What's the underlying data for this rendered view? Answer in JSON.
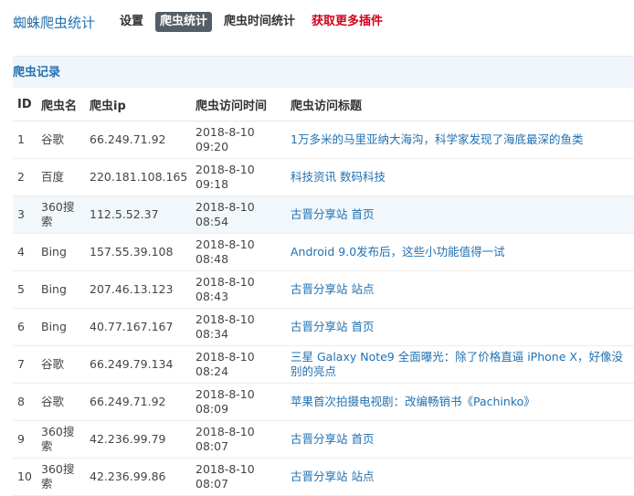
{
  "header": {
    "brand": "蜘蛛爬虫统计",
    "nav": [
      {
        "label": "设置"
      },
      {
        "label": "爬虫统计"
      },
      {
        "label": "爬虫时间统计"
      },
      {
        "label": "获取更多插件"
      }
    ]
  },
  "panel": {
    "title": "爬虫记录",
    "columns": [
      "ID",
      "爬虫名",
      "爬虫ip",
      "爬虫访问时间",
      "爬虫访问标题"
    ],
    "rows": [
      {
        "id": "1",
        "name": "谷歌",
        "ip": "66.249.71.92",
        "date": "2018-8-10",
        "time": "09:20",
        "title": "1万多米的马里亚纳大海沟，科学家发现了海底最深的鱼类"
      },
      {
        "id": "2",
        "name": "百度",
        "ip": "220.181.108.165",
        "date": "2018-8-10",
        "time": "09:18",
        "title": "科技资讯 数码科技"
      },
      {
        "id": "3",
        "name": "360搜索",
        "ip": "112.5.52.37",
        "date": "2018-8-10",
        "time": "08:54",
        "title": "古晋分享站 首页"
      },
      {
        "id": "4",
        "name": "Bing",
        "ip": "157.55.39.108",
        "date": "2018-8-10",
        "time": "08:48",
        "title": "Android 9.0发布后，这些小功能值得一试"
      },
      {
        "id": "5",
        "name": "Bing",
        "ip": "207.46.13.123",
        "date": "2018-8-10",
        "time": "08:43",
        "title": "古晋分享站 站点"
      },
      {
        "id": "6",
        "name": "Bing",
        "ip": "40.77.167.167",
        "date": "2018-8-10",
        "time": "08:34",
        "title": "古晋分享站 首页"
      },
      {
        "id": "7",
        "name": "谷歌",
        "ip": "66.249.79.134",
        "date": "2018-8-10",
        "time": "08:24",
        "title": "三星 Galaxy Note9 全面曝光：除了价格直逼 iPhone X，好像没别的亮点"
      },
      {
        "id": "8",
        "name": "谷歌",
        "ip": "66.249.71.92",
        "date": "2018-8-10",
        "time": "08:09",
        "title": "苹果首次拍摄电视剧：改编畅销书《Pachinko》"
      },
      {
        "id": "9",
        "name": "360搜索",
        "ip": "42.236.99.79",
        "date": "2018-8-10",
        "time": "08:07",
        "title": "古晋分享站 首页"
      },
      {
        "id": "10",
        "name": "360搜索",
        "ip": "42.236.99.86",
        "date": "2018-8-10",
        "time": "08:07",
        "title": "古晋分享站 站点"
      }
    ]
  }
}
